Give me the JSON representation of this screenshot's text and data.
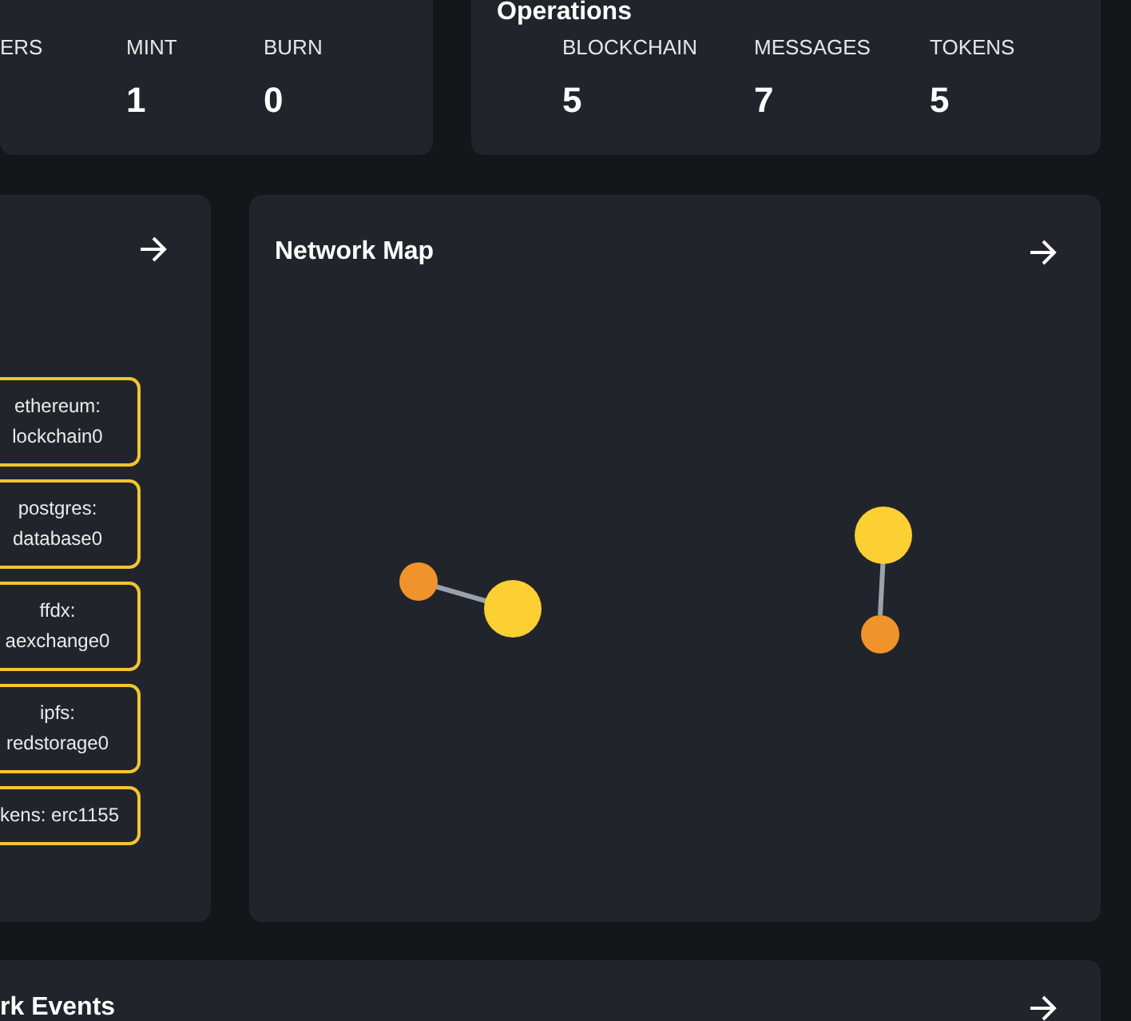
{
  "token_stats": [
    {
      "label": "ERS"
    },
    {
      "label": "MINT",
      "value": "1"
    },
    {
      "label": "BURN",
      "value": "0"
    }
  ],
  "operations": {
    "title": "Operations",
    "stats": [
      {
        "label": "BLOCKCHAIN",
        "value": "5"
      },
      {
        "label": "MESSAGES",
        "value": "7"
      },
      {
        "label": "TOKENS",
        "value": "5"
      }
    ]
  },
  "plugins": {
    "items": [
      {
        "text": "ethereum:\nlockchain0"
      },
      {
        "text": "postgres:\ndatabase0"
      },
      {
        "text": "ffdx:\naexchange0"
      },
      {
        "text": "ipfs:\nredstorage0"
      },
      {
        "text": "kens: erc1155"
      }
    ]
  },
  "network_map": {
    "title": "Network Map"
  },
  "events": {
    "title": "rk Events"
  }
}
